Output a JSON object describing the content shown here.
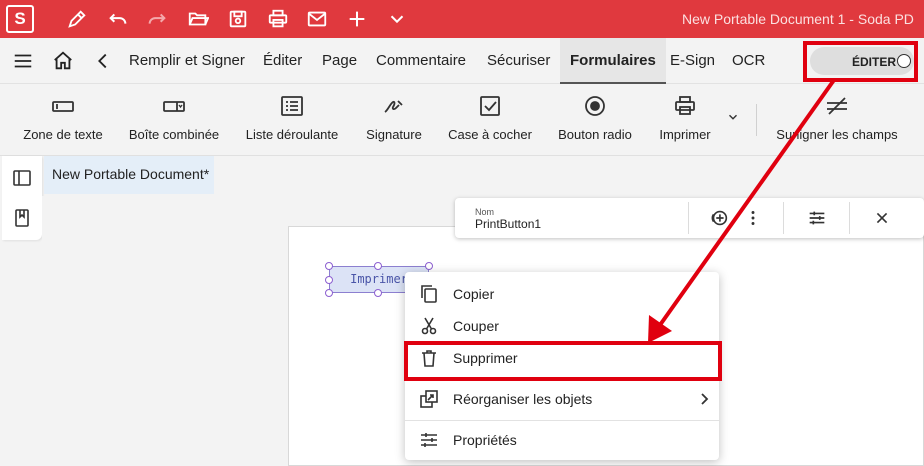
{
  "app": {
    "logo": "S",
    "window_title": "New Portable Document 1  -  Soda PD"
  },
  "quick_access": [
    "pen-icon",
    "undo-icon",
    "redo-icon",
    "open-folder-icon",
    "save-icon",
    "print-icon",
    "mail-icon",
    "add-icon",
    "chevron-down-icon"
  ],
  "tabs": [
    "Remplir et Signer",
    "Éditer",
    "Page",
    "Commentaire",
    "Sécuriser",
    "Formulaires",
    "E-Sign",
    "OCR"
  ],
  "active_tab": "Formulaires",
  "edit_toggle": {
    "label": "ÉDITER"
  },
  "tools": [
    {
      "label": "Zone de texte",
      "icon": "text-field-icon"
    },
    {
      "label": "Boîte combinée",
      "icon": "combo-box-icon"
    },
    {
      "label": "Liste déroulante",
      "icon": "list-box-icon"
    },
    {
      "label": "Signature",
      "icon": "signature-icon"
    },
    {
      "label": "Case à cocher",
      "icon": "checkbox-icon"
    },
    {
      "label": "Bouton radio",
      "icon": "radio-button-icon"
    },
    {
      "label": "Imprimer",
      "icon": "print-icon"
    },
    {
      "label": "Surligner les champs",
      "icon": "highlight-fields-icon"
    }
  ],
  "document": {
    "tab_title": "New Portable Document*"
  },
  "field": {
    "text": "Imprimer"
  },
  "properties_bar": {
    "name_label": "Nom",
    "name_value": "PrintButton1"
  },
  "context_menu": {
    "items": [
      {
        "label": "Copier",
        "icon": "copy-icon"
      },
      {
        "label": "Couper",
        "icon": "scissors-icon"
      },
      {
        "label": "Supprimer",
        "icon": "trash-icon"
      },
      {
        "label": "Réorganiser les objets",
        "icon": "arrange-icon",
        "submenu": true
      },
      {
        "label": "Propriétés",
        "icon": "properties-icon"
      }
    ]
  },
  "colors": {
    "brand": "#e0393e",
    "annotation": "#e0000f"
  }
}
